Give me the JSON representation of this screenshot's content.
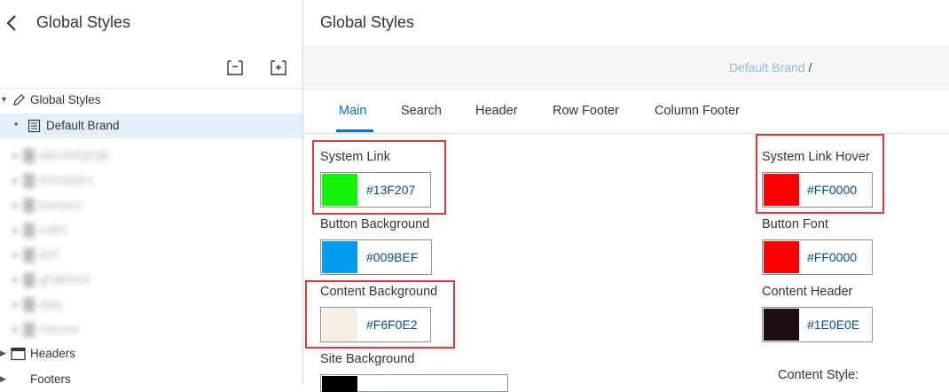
{
  "left_panel": {
    "title": "Global Styles",
    "tree": {
      "root_label": "Global Styles",
      "selected_label": "Default Brand",
      "blurred_items": [
        "abcdefghijk",
        "mnopqrs",
        "tuvwxy",
        "zabc",
        "def",
        "ghijklmn",
        "opq",
        "rstuvw"
      ],
      "headers_label": "Headers",
      "footers_label": "Footers"
    }
  },
  "main": {
    "title": "Global Styles",
    "breadcrumb": {
      "link": "Default Brand",
      "separator": "/"
    },
    "tabs": [
      "Main",
      "Search",
      "Header",
      "Row Footer",
      "Column Footer"
    ],
    "fields": {
      "system_link": {
        "label": "System Link",
        "hex": "#13F207",
        "color": "#13F207"
      },
      "system_link_hover": {
        "label": "System Link Hover",
        "hex": "#FF0000",
        "color": "#FF0000"
      },
      "button_background": {
        "label": "Button Background",
        "hex": "#009BEF",
        "color": "#009BEF"
      },
      "button_font": {
        "label": "Button Font",
        "hex": "#FF0000",
        "color": "#FF0000"
      },
      "content_background": {
        "label": "Content Background",
        "hex": "#F6F0E2",
        "color": "#F6F0E2"
      },
      "content_header": {
        "label": "Content Header",
        "hex": "#1E0E0E",
        "color": "#1E0E0E"
      },
      "site_background": {
        "label": "Site Background",
        "color": "#000000"
      }
    },
    "content_style_label": "Content Style:"
  }
}
